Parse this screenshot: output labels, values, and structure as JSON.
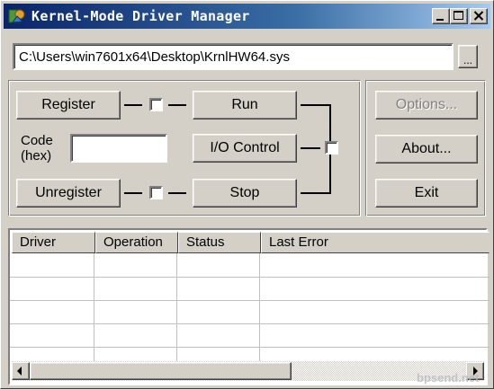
{
  "window": {
    "title": "Kernel-Mode Driver Manager"
  },
  "file": {
    "path": "C:\\Users\\win7601x64\\Desktop\\KrnlHW64.sys",
    "browse_label": "..."
  },
  "controls": {
    "register_label": "Register",
    "unregister_label": "Unregister",
    "run_label": "Run",
    "io_control_label": "I/O Control",
    "stop_label": "Stop",
    "code_label_line1": "Code",
    "code_label_line2": "(hex)",
    "code_value": ""
  },
  "side": {
    "options_label": "Options...",
    "about_label": "About...",
    "exit_label": "Exit"
  },
  "table": {
    "columns": [
      "Driver",
      "Operation",
      "Status",
      "Last Error"
    ],
    "rows": []
  },
  "watermark": "bpsend.net",
  "colors": {
    "titlebar_start": "#0a246a",
    "titlebar_end": "#a6caf0",
    "face": "#d4d0c8"
  }
}
